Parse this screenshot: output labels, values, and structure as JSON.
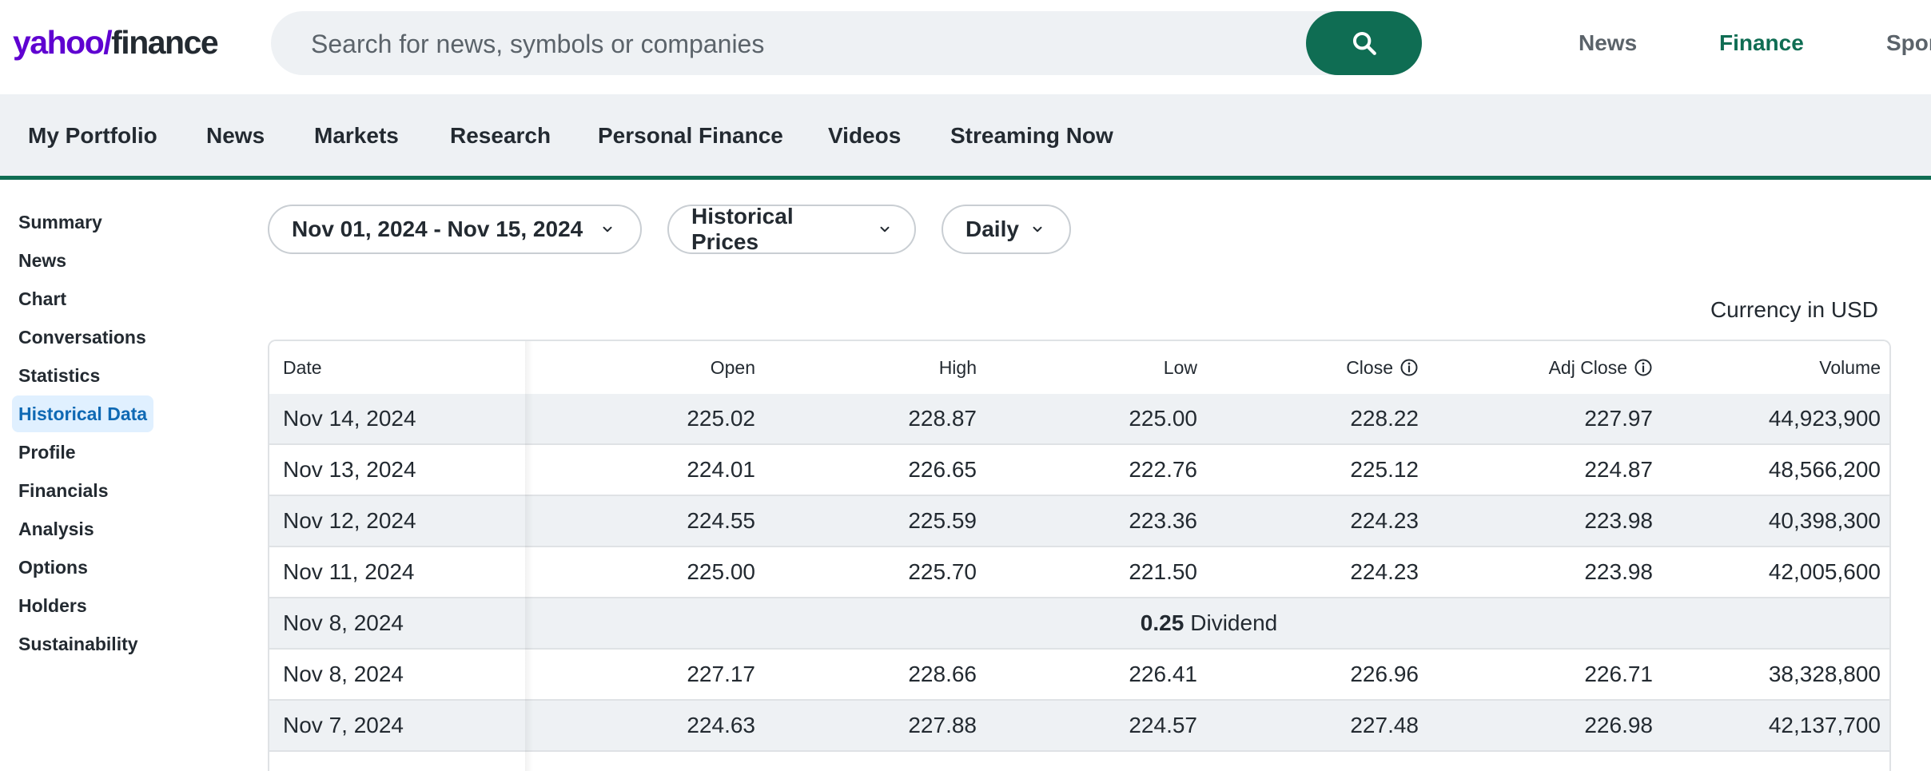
{
  "logo": {
    "part1": "yahoo",
    "mark": "/",
    "part2": "finance"
  },
  "search": {
    "placeholder": "Search for news, symbols or companies"
  },
  "top_nav": {
    "news": "News",
    "finance": "Finance",
    "sports": "Spor"
  },
  "sub_nav": [
    "My Portfolio",
    "News",
    "Markets",
    "Research",
    "Personal Finance",
    "Videos",
    "Streaming Now"
  ],
  "sidebar": [
    "Summary",
    "News",
    "Chart",
    "Conversations",
    "Statistics",
    "Historical Data",
    "Profile",
    "Financials",
    "Analysis",
    "Options",
    "Holders",
    "Sustainability"
  ],
  "filters": {
    "date_range": "Nov 01, 2024 - Nov 15, 2024",
    "type": "Historical Prices",
    "frequency": "Daily"
  },
  "currency": "Currency in USD",
  "table": {
    "headers": {
      "date": "Date",
      "open": "Open",
      "high": "High",
      "low": "Low",
      "close": "Close",
      "adj_close": "Adj Close",
      "volume": "Volume"
    },
    "rows": [
      {
        "date": "Nov 14, 2024",
        "open": "225.02",
        "high": "228.87",
        "low": "225.00",
        "close": "228.22",
        "adj": "227.97",
        "volume": "44,923,900"
      },
      {
        "date": "Nov 13, 2024",
        "open": "224.01",
        "high": "226.65",
        "low": "222.76",
        "close": "225.12",
        "adj": "224.87",
        "volume": "48,566,200"
      },
      {
        "date": "Nov 12, 2024",
        "open": "224.55",
        "high": "225.59",
        "low": "223.36",
        "close": "224.23",
        "adj": "223.98",
        "volume": "40,398,300"
      },
      {
        "date": "Nov 11, 2024",
        "open": "225.00",
        "high": "225.70",
        "low": "221.50",
        "close": "224.23",
        "adj": "223.98",
        "volume": "42,005,600"
      },
      {
        "date": "Nov 8, 2024",
        "dividend_amount": "0.25",
        "dividend_label": "Dividend"
      },
      {
        "date": "Nov 8, 2024",
        "open": "227.17",
        "high": "228.66",
        "low": "226.41",
        "close": "226.96",
        "adj": "226.71",
        "volume": "38,328,800"
      },
      {
        "date": "Nov 7, 2024",
        "open": "224.63",
        "high": "227.88",
        "low": "224.57",
        "close": "227.48",
        "adj": "226.98",
        "volume": "42,137,700"
      }
    ]
  },
  "colors": {
    "brand_purple": "#5f01d1",
    "brand_green": "#0f6d53",
    "active_blue": "#0f69b4",
    "row_shade": "#eef1f4"
  }
}
